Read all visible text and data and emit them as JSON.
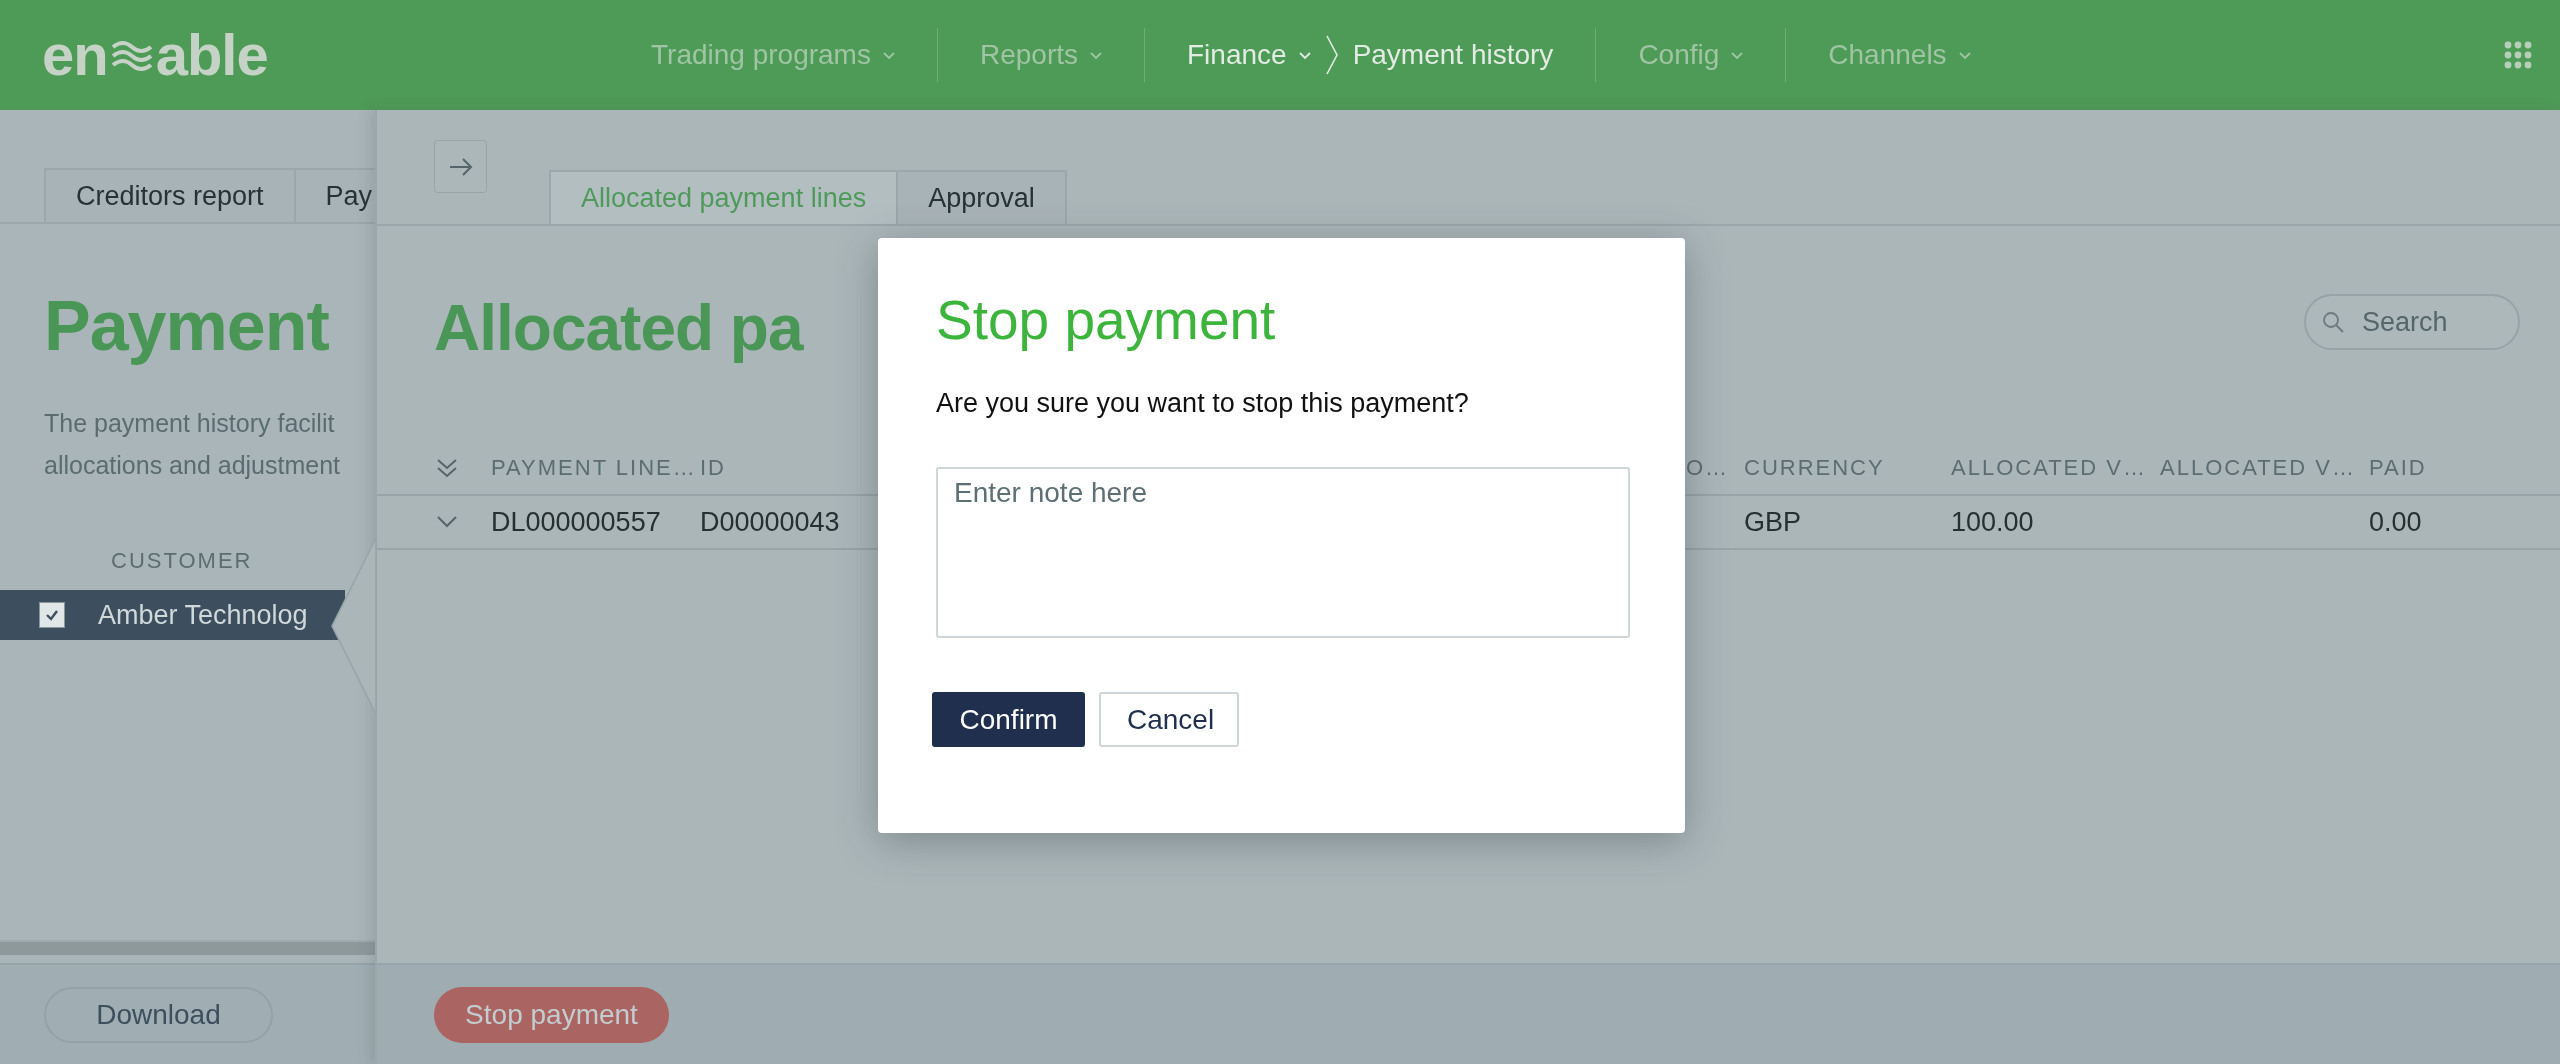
{
  "header": {
    "logo": {
      "left": "en",
      "right": "able"
    },
    "nav": [
      {
        "label": "Trading programs",
        "active": false
      },
      {
        "label": "Reports",
        "active": false
      },
      {
        "label": "Finance",
        "active": true,
        "current": "Payment history"
      },
      {
        "label": "Config",
        "active": false
      },
      {
        "label": "Channels",
        "active": false
      }
    ]
  },
  "left_panel": {
    "tabs": [
      {
        "label": "Creditors report",
        "selected": false
      },
      {
        "label": "Pay",
        "selected": false
      }
    ],
    "title": "Payment",
    "description": [
      "The payment history facilit",
      "allocations and adjustment"
    ],
    "table": {
      "columns": [
        "CUSTOMER"
      ],
      "rows": [
        {
          "customer": "Amber Technolog",
          "selected": true,
          "checked": true
        }
      ]
    },
    "buttons": [
      "Download"
    ]
  },
  "right_panel": {
    "tabs": [
      {
        "label": "Allocated payment lines",
        "selected": true
      },
      {
        "label": "Approval",
        "selected": false
      }
    ],
    "title": "Allocated pa",
    "search": {
      "placeholder": "Search"
    },
    "table": {
      "columns": [
        "PAYMENT LINE…",
        "ID",
        "",
        "O…",
        "CURRENCY",
        "ALLOCATED V…",
        "ALLOCATED V…",
        "PAID"
      ],
      "rows": [
        {
          "expanded": false,
          "cells": [
            "DL000000557",
            "D00000043",
            "",
            "",
            "GBP",
            "100.00",
            "",
            "0.00"
          ]
        }
      ]
    },
    "buttons": [
      "Stop payment"
    ]
  },
  "dialog": {
    "title": "Stop payment",
    "message": "Are you sure you want to stop this payment?",
    "note": {
      "placeholder": "Enter note here"
    },
    "buttons": [
      {
        "label": "Confirm",
        "kind": "primary"
      },
      {
        "label": "Cancel",
        "kind": "secondary"
      }
    ]
  }
}
